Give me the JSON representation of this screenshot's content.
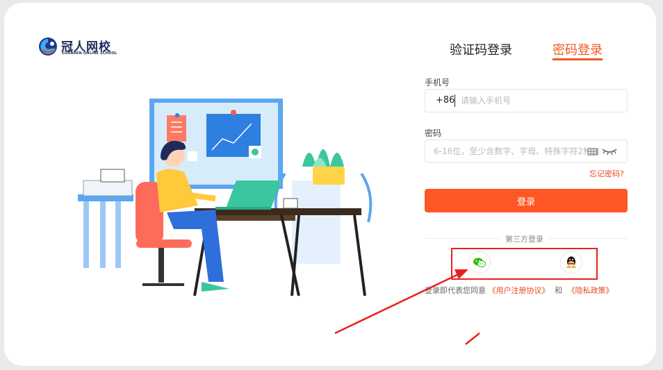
{
  "brand": {
    "name": "冠人网校",
    "subtitle": "GUANREN ONLINE SCHOOL"
  },
  "tabs": [
    {
      "label": "验证码登录",
      "active": false
    },
    {
      "label": "密码登录",
      "active": true
    }
  ],
  "form": {
    "phone_label": "手机号",
    "phone_prefix": "+86",
    "phone_placeholder": "请输入手机号",
    "password_label": "密码",
    "password_placeholder": "6-16位，至少含数字、字母、特殊字符2种",
    "forgot_link": "忘记密码?",
    "submit_label": "登录"
  },
  "third_party": {
    "label": "第三方登录",
    "options": [
      {
        "name": "wechat-icon"
      },
      {
        "name": "qq-icon"
      }
    ]
  },
  "agreement": {
    "prefix": "登录即代表您同意",
    "user_agreement": "《用户注册协议》",
    "conjunction": "和",
    "privacy_policy": "《隐私政策》"
  },
  "colors": {
    "accent": "#ff5626",
    "annotation_red": "#e8201c",
    "brand_navy": "#1f2a5c"
  }
}
